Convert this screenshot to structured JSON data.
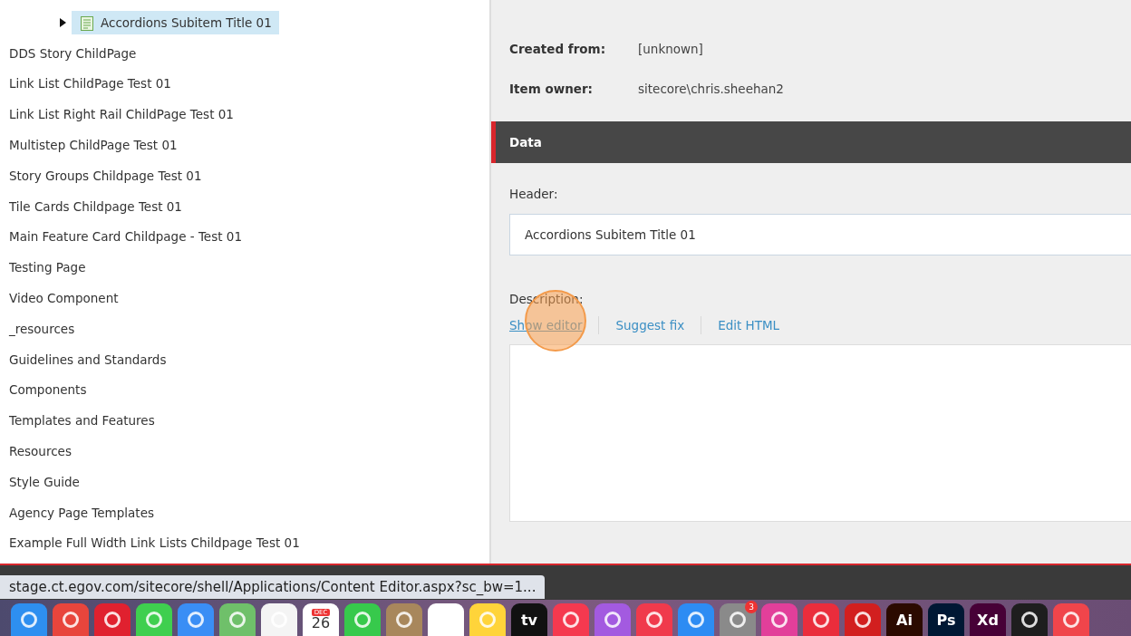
{
  "tree": {
    "items": [
      {
        "label": "Accordions Subitem Title 01",
        "selected": true,
        "kind": "item"
      },
      {
        "label": "DDS Story ChildPage",
        "selected": false,
        "kind": "plain"
      },
      {
        "label": "Link List ChildPage Test 01",
        "selected": false,
        "kind": "plain"
      },
      {
        "label": "Link List Right Rail ChildPage Test 01",
        "selected": false,
        "kind": "plain"
      },
      {
        "label": "Multistep ChildPage Test 01",
        "selected": false,
        "kind": "plain"
      },
      {
        "label": "Story Groups Childpage Test 01",
        "selected": false,
        "kind": "plain"
      },
      {
        "label": "Tile Cards Childpage Test 01",
        "selected": false,
        "kind": "plain"
      },
      {
        "label": "Main Feature Card Childpage - Test 01",
        "selected": false,
        "kind": "plain"
      },
      {
        "label": "Testing Page",
        "selected": false,
        "kind": "plain"
      },
      {
        "label": "Video Component",
        "selected": false,
        "kind": "plain"
      },
      {
        "label": "_resources",
        "selected": false,
        "kind": "plain"
      },
      {
        "label": "Guidelines and Standards",
        "selected": false,
        "kind": "plain"
      },
      {
        "label": "Components",
        "selected": false,
        "kind": "plain"
      },
      {
        "label": "Templates and Features",
        "selected": false,
        "kind": "plain"
      },
      {
        "label": "Resources",
        "selected": false,
        "kind": "plain"
      },
      {
        "label": "Style Guide",
        "selected": false,
        "kind": "plain"
      },
      {
        "label": "Agency Page Templates",
        "selected": false,
        "kind": "plain"
      },
      {
        "label": "Example Full Width Link Lists Childpage Test 01",
        "selected": false,
        "kind": "plain"
      }
    ]
  },
  "info": [
    {
      "label": "Created from:",
      "value": "[unknown]"
    },
    {
      "label": "Item owner:",
      "value": "sitecore\\chris.sheehan2"
    }
  ],
  "section": {
    "title": "Data"
  },
  "fields": {
    "header_label": "Header:",
    "header_value": "Accordions Subitem Title 01",
    "description_label": "Description:",
    "links": [
      {
        "label": "Show editor",
        "hovered": true
      },
      {
        "label": "Suggest fix",
        "hovered": false
      },
      {
        "label": "Edit HTML",
        "hovered": false
      }
    ]
  },
  "click_highlight": {
    "visible": true
  },
  "status_url": "stage.ct.egov.com/sitecore/shell/Applications/Content Editor.aspx?sc_bw=1...",
  "dock": [
    {
      "kind": "safari",
      "color": "#2e8ff0"
    },
    {
      "kind": "chrome",
      "color": "#e8453c"
    },
    {
      "kind": "opera",
      "color": "#e0212f"
    },
    {
      "kind": "messages",
      "color": "#3fcf4f"
    },
    {
      "kind": "mail",
      "color": "#3a8ef5"
    },
    {
      "kind": "maps",
      "color": "#6fc06a"
    },
    {
      "kind": "photos",
      "color": "#f4f4f4"
    },
    {
      "kind": "calendar",
      "color": "#ffffff",
      "month": "DEC",
      "day": "26"
    },
    {
      "kind": "facetime",
      "color": "#37c94c"
    },
    {
      "kind": "contacts",
      "color": "#a8875c"
    },
    {
      "kind": "reminders",
      "color": "#ffffff"
    },
    {
      "kind": "notes",
      "color": "#ffd43a"
    },
    {
      "kind": "text",
      "color": "#111111",
      "text": "tv"
    },
    {
      "kind": "music",
      "color": "#f5394f"
    },
    {
      "kind": "podcasts",
      "color": "#a35ae0"
    },
    {
      "kind": "news",
      "color": "#f03a4c"
    },
    {
      "kind": "appstore",
      "color": "#2d8cf3"
    },
    {
      "kind": "settings",
      "color": "#8a8a8a",
      "badge": "3"
    },
    {
      "kind": "app",
      "color": "#e23f9a"
    },
    {
      "kind": "creativecloud",
      "color": "#ea2d3c"
    },
    {
      "kind": "acrobat",
      "color": "#d21f1f"
    },
    {
      "kind": "text",
      "color": "#2b0a00",
      "text": "Ai"
    },
    {
      "kind": "text",
      "color": "#001834",
      "text": "Ps"
    },
    {
      "kind": "text",
      "color": "#470137",
      "text": "Xd"
    },
    {
      "kind": "figma",
      "color": "#1e1e1e"
    },
    {
      "kind": "app",
      "color": "#f0454b"
    }
  ]
}
